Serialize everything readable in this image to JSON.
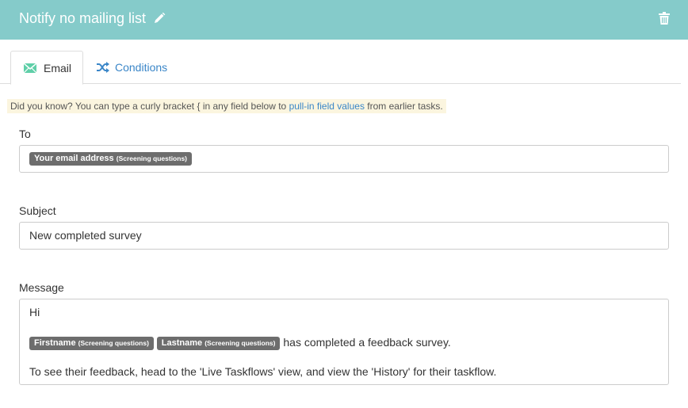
{
  "header": {
    "title": "Notify no mailing list",
    "edit_icon": "pencil-icon",
    "delete_icon": "trash-icon"
  },
  "tabs": [
    {
      "label": "Email",
      "icon": "envelope-icon",
      "active": true
    },
    {
      "label": "Conditions",
      "icon": "shuffle-icon",
      "active": false
    }
  ],
  "tip": {
    "prefix": "Did you know? You can type a curly bracket { in any field below to",
    "link": "pull-in field values",
    "suffix": "from earlier tasks."
  },
  "fields": {
    "to": {
      "label": "To",
      "chips": [
        {
          "name": "Your email address",
          "source": "(Screening questions)"
        }
      ]
    },
    "subject": {
      "label": "Subject",
      "value": "New completed survey"
    },
    "message": {
      "label": "Message",
      "line1": "Hi",
      "chips": [
        {
          "name": "Firstname",
          "source": "(Screening questions)"
        },
        {
          "name": "Lastname",
          "source": "(Screening questions)"
        }
      ],
      "line2_text": "has completed a feedback survey.",
      "line3": "To see their feedback, head to the 'Live Taskflows' view, and view the 'History' for their taskflow."
    }
  },
  "colors": {
    "header_bg": "#85cbca",
    "link": "#3a86c8",
    "tip_bg": "#fbf5df",
    "chip_bg": "#6d6d6d",
    "envelope_icon": "#5fcfa8"
  }
}
